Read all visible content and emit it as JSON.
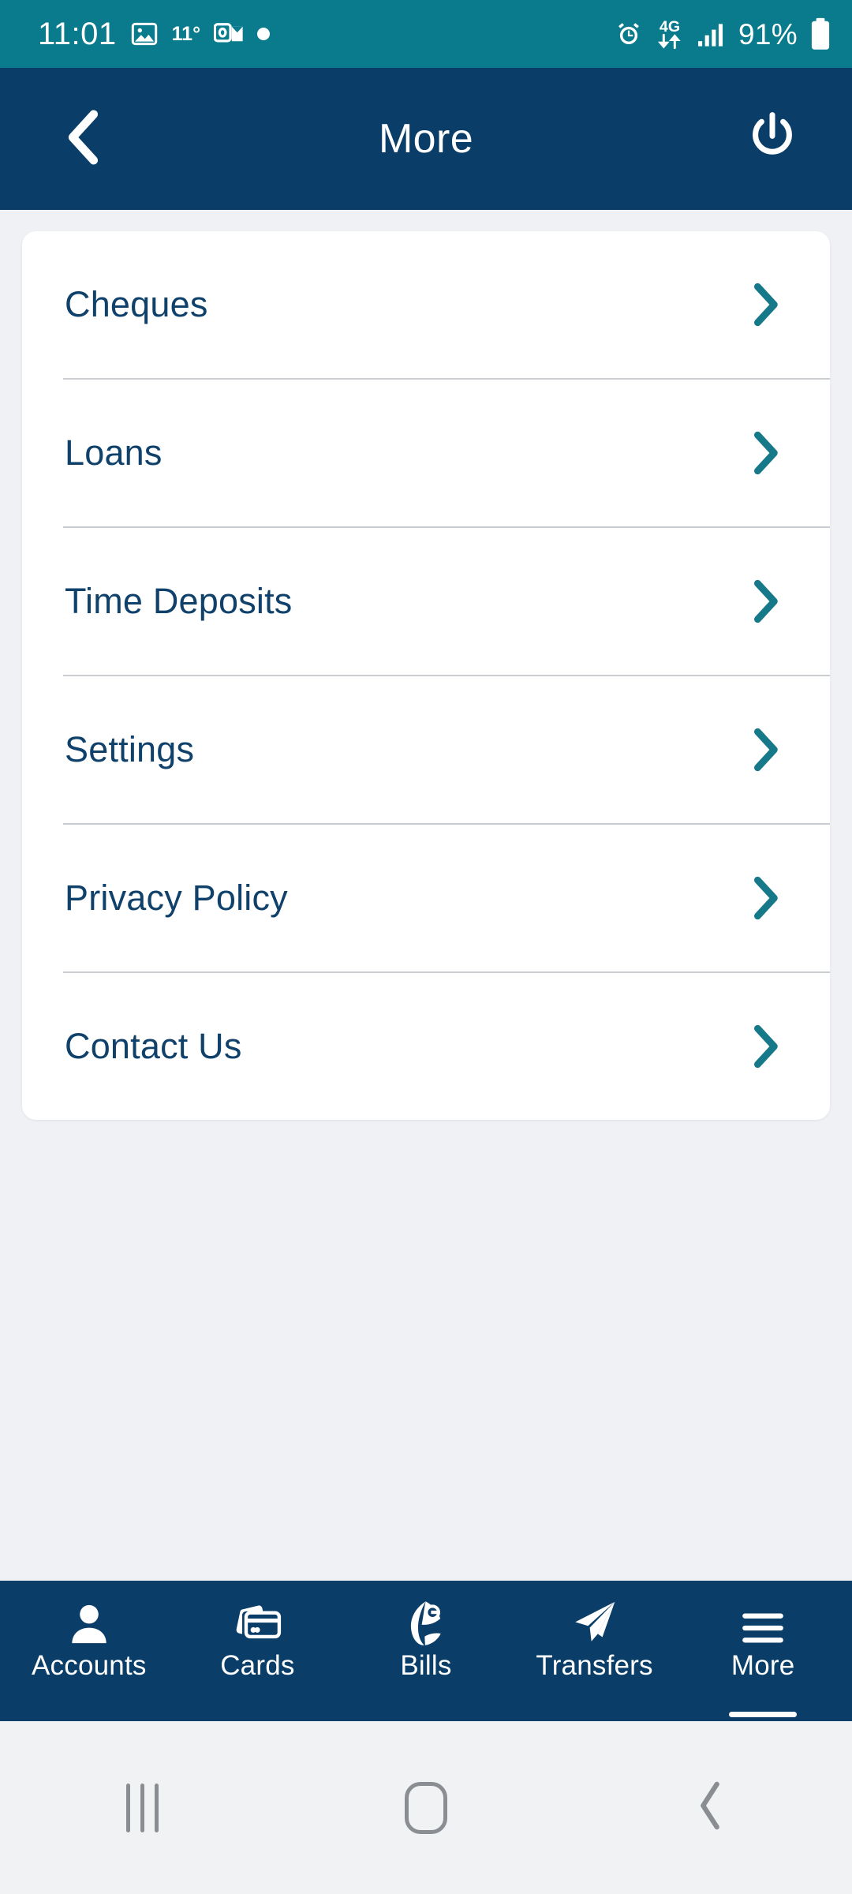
{
  "status_bar": {
    "time": "11:01",
    "temperature": "11°",
    "battery_percent": "91%",
    "left_icons": [
      "photo-icon",
      "outlook-icon",
      "dot-indicator-icon"
    ],
    "right_icons": [
      "alarm-icon",
      "network-4g-icon",
      "signal-bars-icon",
      "battery-icon"
    ],
    "network_label": "4G",
    "background_color": "#0a7b8c"
  },
  "header": {
    "title": "More",
    "back_icon": "chevron-left-icon",
    "logout_icon": "power-icon",
    "background_color": "#0a3e68"
  },
  "menu": {
    "items": [
      {
        "label": "Cheques",
        "chevron": "chevron-right-icon"
      },
      {
        "label": "Loans",
        "chevron": "chevron-right-icon"
      },
      {
        "label": "Time Deposits",
        "chevron": "chevron-right-icon"
      },
      {
        "label": "Settings",
        "chevron": "chevron-right-icon"
      },
      {
        "label": "Privacy Policy",
        "chevron": "chevron-right-icon"
      },
      {
        "label": "Contact Us",
        "chevron": "chevron-right-icon"
      }
    ],
    "label_color": "#10416b",
    "chevron_color": "#15798a",
    "card_background": "#ffffff"
  },
  "bottom_nav": {
    "items": [
      {
        "label": "Accounts",
        "icon": "person-icon",
        "active": false
      },
      {
        "label": "Cards",
        "icon": "credit-cards-icon",
        "active": false
      },
      {
        "label": "Bills",
        "icon": "e-bill-icon",
        "active": false
      },
      {
        "label": "Transfers",
        "icon": "paper-plane-icon",
        "active": false
      },
      {
        "label": "More",
        "icon": "hamburger-icon",
        "active": true
      }
    ],
    "background_color": "#0a3e68",
    "active_color": "#ffffff"
  },
  "system_nav": {
    "recents_icon": "recents-icon",
    "home_icon": "home-icon",
    "back_icon": "system-back-icon",
    "background_color": "#f1f2f4"
  },
  "page_background": "#eff1f4"
}
